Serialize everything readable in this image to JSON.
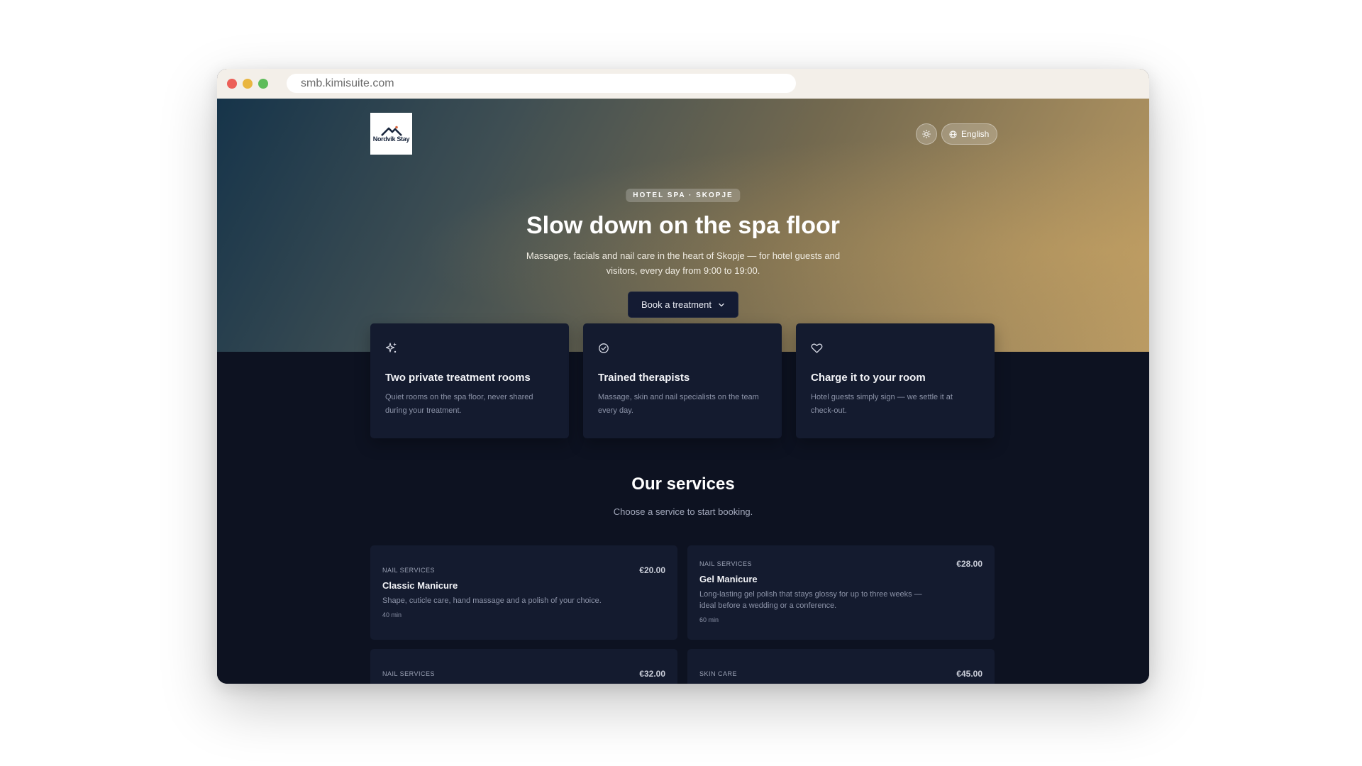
{
  "browser": {
    "url": "smb.kimisuite.com"
  },
  "header": {
    "logo_text": "Nordvik Stay",
    "language_label": "English"
  },
  "hero": {
    "badge": "HOTEL SPA · SKOPJE",
    "title": "Slow down on the spa floor",
    "subtitle": "Massages, facials and nail care in the heart of Skopje — for hotel guests and visitors, every day from 9:00 to 19:00.",
    "cta_label": "Book a treatment"
  },
  "features": [
    {
      "icon": "sparkles-icon",
      "title": "Two private treatment rooms",
      "description": "Quiet rooms on the spa floor, never shared during your treatment."
    },
    {
      "icon": "check-circle-icon",
      "title": "Trained therapists",
      "description": "Massage, skin and nail specialists on the team every day."
    },
    {
      "icon": "heart-icon",
      "title": "Charge it to your room",
      "description": "Hotel guests simply sign — we settle it at check-out."
    }
  ],
  "services_section": {
    "title": "Our services",
    "subtitle": "Choose a service to start booking.",
    "items": [
      {
        "category": "Nail services",
        "name": "Classic Manicure",
        "description": "Shape, cuticle care, hand massage and a polish of your choice.",
        "duration": "40 min",
        "price": "€20.00"
      },
      {
        "category": "Nail services",
        "name": "Gel Manicure",
        "description": "Long-lasting gel polish that stays glossy for up to three weeks — ideal before a wedding or a conference.",
        "duration": "60 min",
        "price": "€28.00"
      },
      {
        "category": "Nail services",
        "price": "€32.00"
      },
      {
        "category": "Skin care",
        "price": "€45.00"
      }
    ]
  },
  "colors": {
    "background": "#0d1221",
    "card": "#141b2f",
    "hero_start": "#16344a",
    "hero_end": "#b99a63"
  }
}
